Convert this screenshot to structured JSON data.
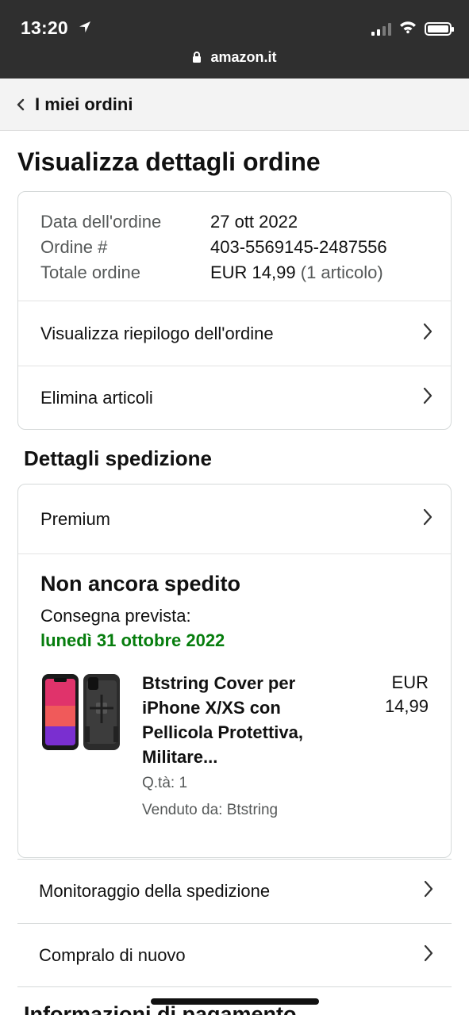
{
  "status_bar": {
    "time": "13:20",
    "url": "amazon.it"
  },
  "nav": {
    "back_label": "I miei ordini"
  },
  "page": {
    "title": "Visualizza dettagli ordine"
  },
  "order": {
    "date_label": "Data dell'ordine",
    "date_value": "27 ott 2022",
    "number_label": "Ordine #",
    "number_value": "403-5569145-2487556",
    "total_label": "Totale ordine",
    "total_value": "EUR 14,99",
    "total_items": "(1 articolo)",
    "summary_link": "Visualizza riepilogo dell'ordine",
    "delete_link": "Elimina articoli"
  },
  "shipping": {
    "section_title": "Dettagli spedizione",
    "service": "Premium",
    "status": "Non ancora spedito",
    "delivery_label": "Consegna prevista:",
    "delivery_date": "lunedì 31 ottobre 2022",
    "item": {
      "name": "Btstring Cover per iPhone X/XS con Pellicola Protettiva, Militare...",
      "price_currency": "EUR",
      "price_value": "14,99",
      "quantity": "Q.tà: 1",
      "seller": "Venduto da: Btstring"
    }
  },
  "actions": {
    "track": "Monitoraggio della spedizione",
    "buy_again": "Compralo di nuovo"
  },
  "next_section_title": "Informazioni di pagamento",
  "colors": {
    "status_bar": "#2f2f2f",
    "delivery_green": "#067d0d",
    "border": "#d5d9d9"
  }
}
